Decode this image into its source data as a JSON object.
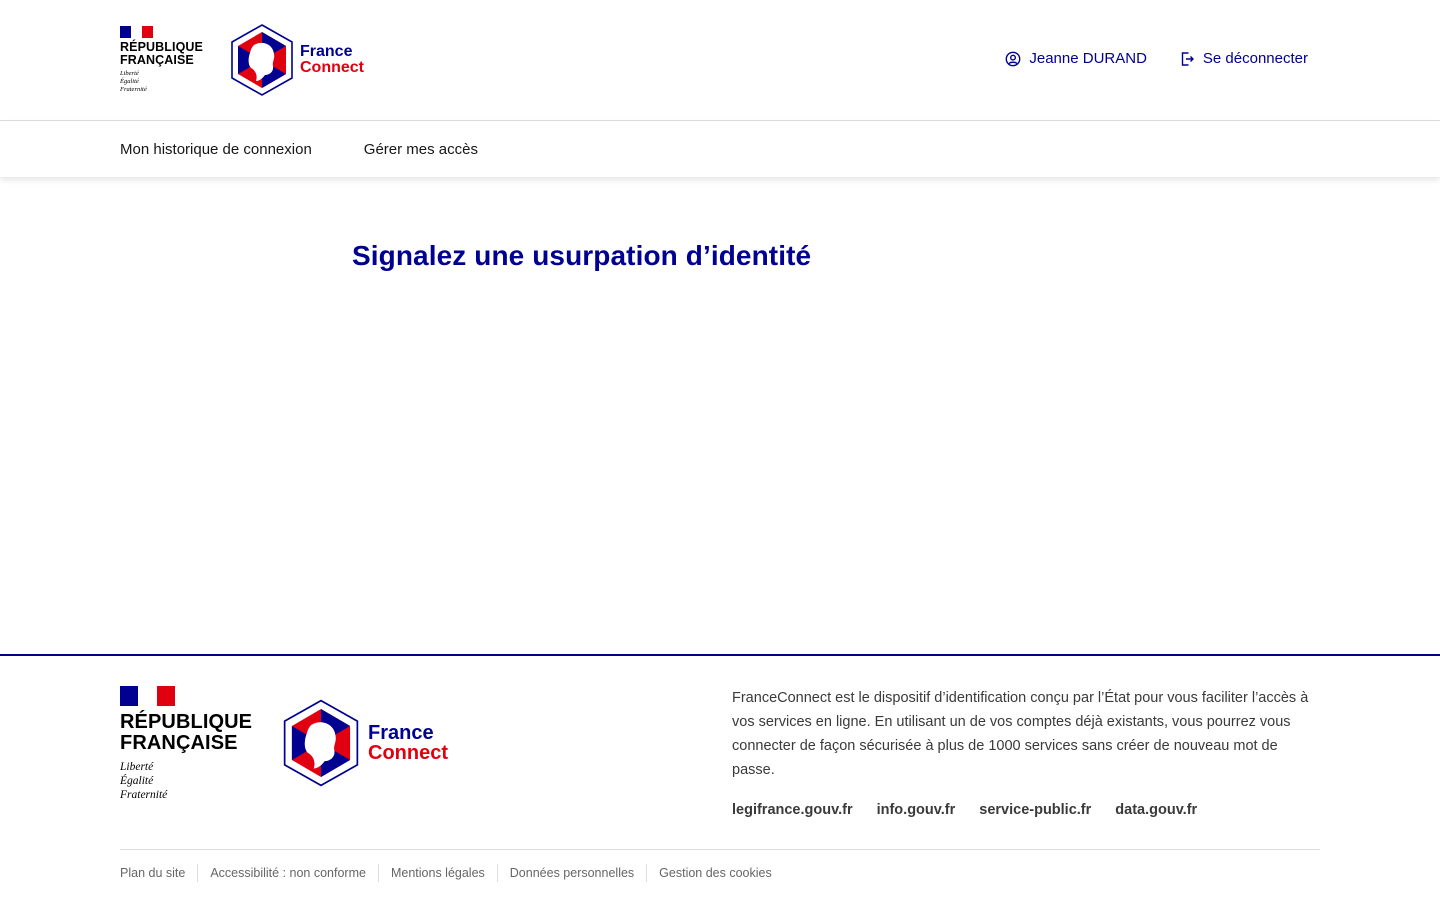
{
  "header": {
    "republique": [
      "RÉPUBLIQUE",
      "FRANÇAISE"
    ],
    "motto": [
      "Liberté",
      "Égalité",
      "Fraternité"
    ],
    "fc_logo": {
      "line1": "France",
      "line2": "Connect"
    },
    "user_name": "Jeanne DURAND",
    "logout_label": "Se déconnecter",
    "user_icon": "user-circle-icon",
    "logout_icon": "logout-icon"
  },
  "nav": {
    "items": [
      "Mon historique de connexion",
      "Gérer mes accès"
    ]
  },
  "main": {
    "title": "Signalez une usurpation d’identité"
  },
  "footer": {
    "republique": [
      "RÉPUBLIQUE",
      "FRANÇAISE"
    ],
    "motto": [
      "Liberté",
      "Égalité",
      "Fraternité"
    ],
    "fc_logo": {
      "line1": "France",
      "line2": "Connect"
    },
    "description": "FranceConnect est le dispositif d’identification conçu par l’État pour vous faciliter l’accès à vos services en ligne. En utilisant un de vos comptes déjà existants, vous pourrez vous connecter de façon sécurisée à plus de 1000 services sans créer de nouveau mot de passe.",
    "sites": [
      "legifrance.gouv.fr",
      "info.gouv.fr",
      "service-public.fr",
      "data.gouv.fr"
    ],
    "bottom_links": [
      "Plan du site",
      "Accessibilité : non conforme",
      "Mentions légales",
      "Données personnelles",
      "Gestion des cookies"
    ]
  },
  "colors": {
    "blue_france": "#000091",
    "red_marianne": "#e1000f",
    "text": "#161616",
    "muted": "#666666"
  }
}
